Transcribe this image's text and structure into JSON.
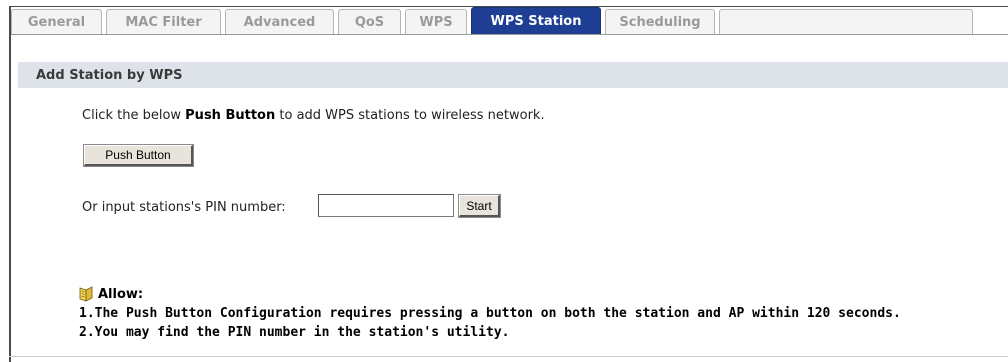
{
  "tabs": [
    {
      "label": "General",
      "active": false
    },
    {
      "label": "MAC Filter",
      "active": false
    },
    {
      "label": "Advanced",
      "active": false
    },
    {
      "label": "QoS",
      "active": false
    },
    {
      "label": "WPS",
      "active": false
    },
    {
      "label": "WPS Station",
      "active": true
    },
    {
      "label": "Scheduling",
      "active": false
    }
  ],
  "section": {
    "title": "Add Station by WPS"
  },
  "description": {
    "before": "Click the below ",
    "bold": "Push Button",
    "after": " to add WPS stations to wireless network."
  },
  "push_button": {
    "label": "Push Button"
  },
  "pin": {
    "label": "Or input stations's PIN number:",
    "value": "",
    "start_label": "Start"
  },
  "note": {
    "heading": "Allow:",
    "icon": "note-book-icon",
    "lines": [
      "1.The Push Button Configuration requires pressing a button on both the station and AP within 120 seconds.",
      "2.You may find the PIN number in the station's utility."
    ]
  },
  "colors": {
    "active_tab": "#1f3f95",
    "section_bar": "#dde3e8",
    "inactive_tab_text": "#9a9a9a"
  }
}
